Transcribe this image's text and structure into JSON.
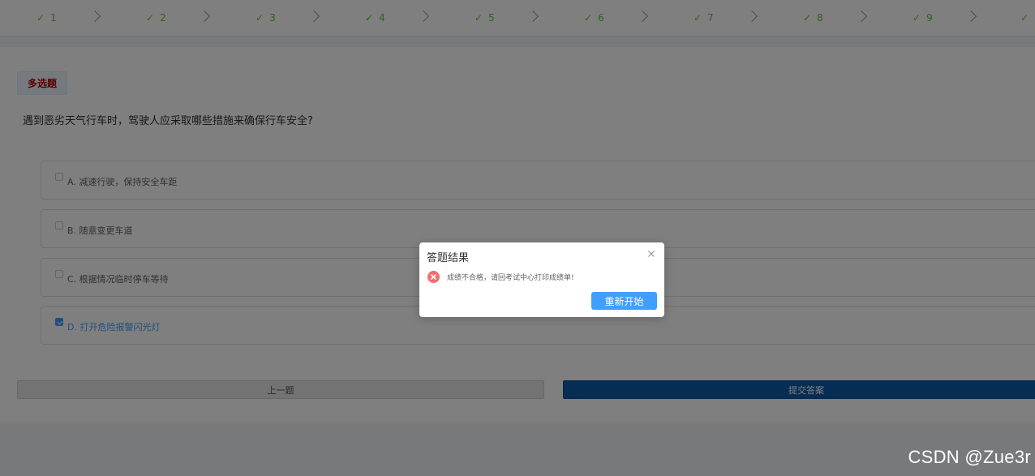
{
  "steps": [
    "1",
    "2",
    "3",
    "4",
    "5",
    "6",
    "7",
    "8",
    "9",
    ""
  ],
  "question": {
    "type_label": "多选题",
    "text": "遇到恶劣天气行车时，驾驶人应采取哪些措施来确保行车安全?",
    "options": [
      {
        "label": "A. 减速行驶，保持安全车距",
        "checked": false
      },
      {
        "label": "B. 随意变更车道",
        "checked": false
      },
      {
        "label": "C. 根据情况临时停车等待",
        "checked": false
      },
      {
        "label": "D. 打开危险报警闪光灯",
        "checked": true
      }
    ]
  },
  "buttons": {
    "prev_label": "上一题",
    "submit_label": "提交答案"
  },
  "dialog": {
    "title": "答题结果",
    "message": "成绩不合格，请回考试中心打印成绩单!",
    "restart_label": "重新开始",
    "error_color": "#f56c6c",
    "button_color": "#409eff"
  },
  "colors": {
    "success": "#67c23a",
    "selected": "#409eff",
    "submit_bg": "#0d5aa8",
    "tag_text": "#b30000"
  },
  "watermark": "CSDN @Zue3r"
}
